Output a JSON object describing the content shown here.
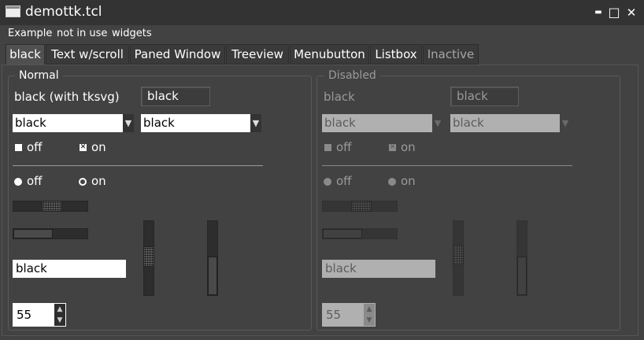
{
  "window": {
    "title": "demottk.tcl",
    "minimize": "▬",
    "maximize": "□",
    "close": "✕"
  },
  "menu": [
    "Example",
    "not in use",
    "widgets"
  ],
  "tabs": [
    {
      "label": "black",
      "active": true
    },
    {
      "label": "Text w/scroll"
    },
    {
      "label": "Paned Window"
    },
    {
      "label": "Treeview"
    },
    {
      "label": "Menubutton"
    },
    {
      "label": "Listbox"
    },
    {
      "label": "Inactive",
      "dim": true
    }
  ],
  "normal": {
    "frame_label": "Normal",
    "label": "black (with tksvg)",
    "button": "black",
    "combo1": "black",
    "combo2": "black",
    "check_off": "off",
    "check_on": "on",
    "radio_off": "off",
    "radio_on": "on",
    "entry": "black",
    "spinbox": "55"
  },
  "disabled": {
    "frame_label": "Disabled",
    "label": "black",
    "button": "black",
    "combo1": "black",
    "combo2": "black",
    "check_off": "off",
    "check_on": "on",
    "radio_off": "off",
    "radio_on": "on",
    "entry": "black",
    "spinbox": "55"
  },
  "glyphs": {
    "arrow_down": "▼",
    "arrow_up": "▲",
    "check_mark": "✕"
  },
  "colors": {
    "background": "#424242",
    "titlebar": "#333333",
    "field": "#ffffff",
    "disabled_field": "#b0b0b0"
  }
}
